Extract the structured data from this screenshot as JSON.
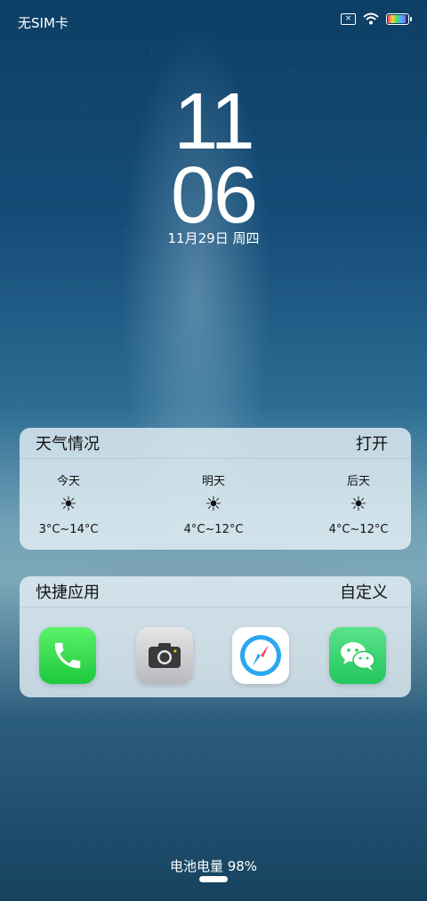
{
  "status_bar": {
    "carrier": "无SIM卡",
    "icons": [
      "no-sim-icon",
      "wifi-icon",
      "battery-icon"
    ]
  },
  "clock": {
    "hour": "11",
    "minute": "06"
  },
  "date": "11月29日 周四",
  "weather_card": {
    "title": "天气情况",
    "action": "打开",
    "days": [
      {
        "label": "今天",
        "icon": "sun-icon",
        "temp": "3°C~14°C"
      },
      {
        "label": "明天",
        "icon": "sun-icon",
        "temp": "4°C~12°C"
      },
      {
        "label": "后天",
        "icon": "sun-icon",
        "temp": "4°C~12°C"
      }
    ]
  },
  "shortcuts_card": {
    "title": "快捷应用",
    "action": "自定义",
    "apps": [
      "phone-app-icon",
      "camera-app-icon",
      "browser-app-icon",
      "wechat-app-icon"
    ]
  },
  "battery": {
    "text": "电池电量 98%",
    "level_percent": 98
  },
  "colors": {
    "accent_green": "#1cc83c",
    "wechat_green": "#23c75f",
    "browser_blue": "#2aa7f0"
  }
}
